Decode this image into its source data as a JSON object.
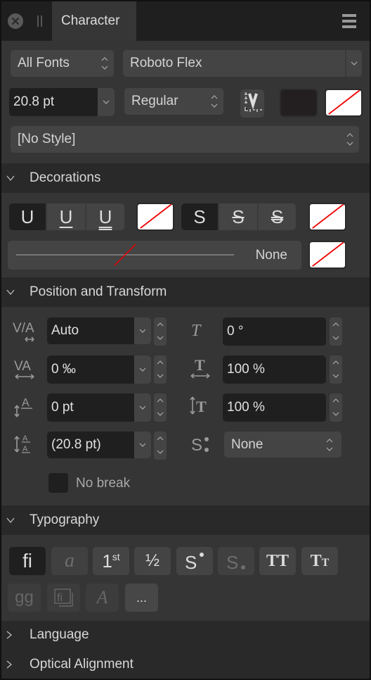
{
  "titlebar": {
    "tab_label": "Character",
    "close_icon": "close-icon",
    "grip_icon": "grip-icon",
    "menu_icon": "hamburger-menu-icon"
  },
  "font": {
    "collection": "All Fonts",
    "family": "Roboto Flex",
    "size": "20.8 pt",
    "style": "Regular",
    "paragraph_style": "[No Style]",
    "fill_color": "#231f20",
    "stroke_color": "none"
  },
  "decorations": {
    "title": "Decorations",
    "underline_options": [
      "U",
      "U",
      "U"
    ],
    "underline_selected": 0,
    "strike_options": [
      "S",
      "S",
      "S"
    ],
    "strike_selected": 0,
    "line_style_label": "None"
  },
  "position": {
    "title": "Position and Transform",
    "tracking": "Auto",
    "kerning": "0 ‰",
    "baseline_shift": "0 pt",
    "leading": "(20.8 pt)",
    "shear": "0 °",
    "horizontal_scale": "100 %",
    "vertical_scale": "100 %",
    "subscript_superscript": "None",
    "no_break_label": "No break",
    "no_break_checked": false
  },
  "typography": {
    "title": "Typography",
    "row1": [
      {
        "name": "ligatures",
        "glyph": "fi",
        "state": "on"
      },
      {
        "name": "swash",
        "glyph": "a",
        "state": "dim"
      },
      {
        "name": "ordinals",
        "glyph": "1st",
        "state": "normal"
      },
      {
        "name": "fractions",
        "glyph": "½",
        "state": "normal"
      },
      {
        "name": "superscript",
        "glyph": "S•",
        "state": "normal"
      },
      {
        "name": "subscript",
        "glyph": "S.",
        "state": "dim"
      },
      {
        "name": "all-caps",
        "glyph": "TT",
        "state": "normal"
      },
      {
        "name": "small-caps",
        "glyph": "Tт",
        "state": "normal"
      }
    ],
    "row2": [
      {
        "name": "stylistic-alternates",
        "glyph": "gg"
      },
      {
        "name": "discretionary-ligatures",
        "glyph": "fi"
      },
      {
        "name": "contextual-alternates",
        "glyph": "A"
      },
      {
        "name": "more-options",
        "glyph": "..."
      }
    ]
  },
  "collapsed_sections": [
    "Language",
    "Optical Alignment"
  ]
}
